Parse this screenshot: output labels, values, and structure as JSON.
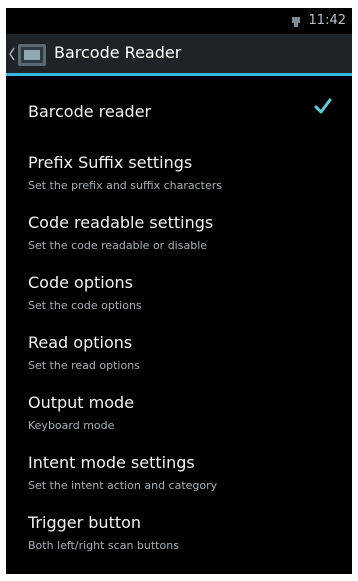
{
  "status_bar": {
    "time": "11:42",
    "usb_icon": "usb-icon"
  },
  "action_bar": {
    "title": "Barcode Reader",
    "back_icon": "back-chevron-icon",
    "app_icon": "barcode-reader-app-icon"
  },
  "settings": [
    {
      "title": "Barcode reader",
      "checked": true
    },
    {
      "title": "Prefix Suffix settings",
      "summary": "Set the prefix and suffix characters"
    },
    {
      "title": "Code readable settings",
      "summary": "Set the code readable or disable"
    },
    {
      "title": "Code options",
      "summary": "Set the code options"
    },
    {
      "title": "Read options",
      "summary": "Set the read options"
    },
    {
      "title": "Output mode",
      "summary": "Keyboard mode"
    },
    {
      "title": "Intent mode settings",
      "summary": "Set the intent action and category"
    },
    {
      "title": "Trigger button",
      "summary": "Both left/right scan buttons"
    }
  ],
  "colors": {
    "accent": "#33b5e5",
    "check": "#67c8d9"
  }
}
